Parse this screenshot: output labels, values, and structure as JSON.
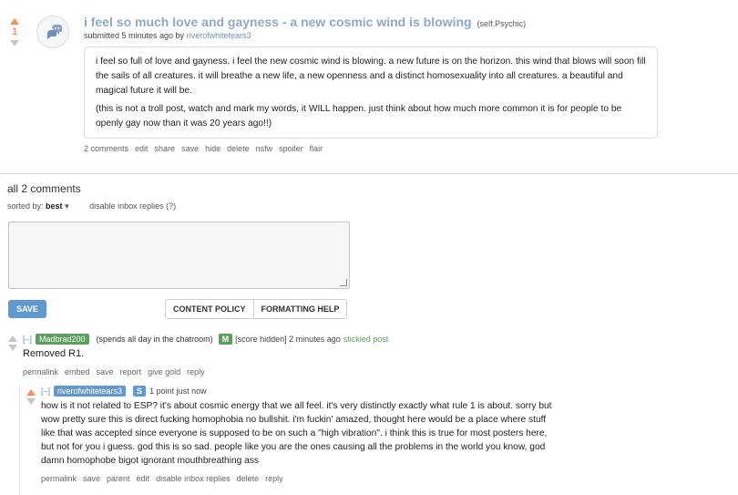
{
  "post": {
    "score": "1",
    "title": "i feel so much love and gayness - a new cosmic wind is blowing",
    "domain": "(self.Psychic)",
    "submitted_prefix": "submitted 5 minutes ago by",
    "author": "riverofwhitetears3",
    "selftext": [
      "i feel so full of love and gayness. i feel the new cosmic wind is blowing. a new future is on the horizon. this wind that blows will soon fill the sails of all creatures. it will breathe a new life, a new openness and a distinct homosexuality into all creatures. a beautiful and magical future it will be.",
      "(this is not a troll post, watch and mark my words, it WILL happen. just think about how much more common it is for people to be openly gay now than it was 20 years ago!!)"
    ],
    "buttons": [
      "2 comments",
      "edit",
      "share",
      "save",
      "hide",
      "delete",
      "nsfw",
      "spoiler",
      "flair"
    ]
  },
  "comments_section": {
    "title": "all 2 comments",
    "sorted_by_label": "sorted by:",
    "sort_value": "best",
    "sort_caret": "▾",
    "disable_inbox": "disable inbox replies (?)",
    "save_label": "SAVE",
    "content_policy": "CONTENT POLICY",
    "formatting_help": "FORMATTING HELP"
  },
  "comments": [
    {
      "collapse": "[–]",
      "author": "Madbrad200",
      "flair": "(spends all day in the chatroom)",
      "badge": "M",
      "meta": "[score hidden] 2 minutes ago",
      "stickied": "stickied post",
      "body": "Removed R1.",
      "buttons": [
        "permalink",
        "embed",
        "save",
        "report",
        "give gold",
        "reply"
      ]
    },
    {
      "collapse": "[–]",
      "author": "riverofwhitetears3",
      "badge": "S",
      "meta": "1 point just now",
      "body_lines": [
        "how is it not related to ESP? it's about cosmic energy that we all feel. it's very distinctly exactly what rule 1 is about. sorry but",
        "wow pretty sure this is direct fucking homophobia no bullshit. i'm fuckin' amazed, thought here would be a place where stuff",
        "like that was accepted since everyone is supposed to be on such a \"high vibration\". i think this is true for most posters here,",
        "but not for you i guess. god this is so sad. people like you are the ones causing all the problems in the world you know, god",
        "damn homophobe bigot ignorant mouthbreathing ass"
      ],
      "buttons": [
        "permalink",
        "save",
        "parent",
        "edit",
        "disable inbox replies",
        "delete",
        "reply"
      ]
    }
  ],
  "colors": {
    "upvote": "#ff8b60",
    "title_link": "#8ea8c9",
    "save_button": "#5f99cf",
    "mod_green": "#5c9e5c"
  }
}
